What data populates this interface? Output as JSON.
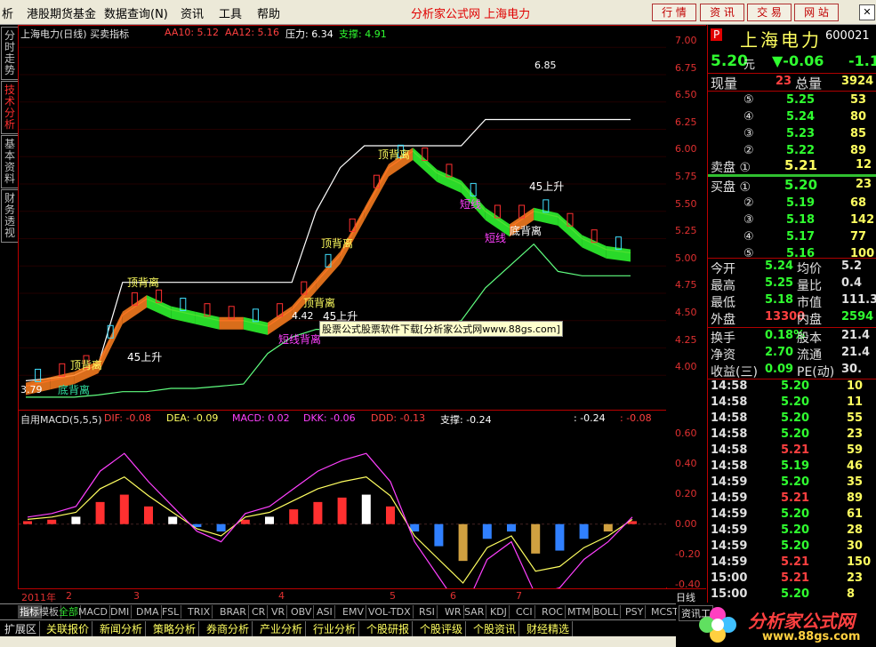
{
  "menu": {
    "items": [
      "析",
      "港股期货基金",
      "数据查询(N)",
      "资讯",
      "工具",
      "帮助"
    ],
    "center_title": "分析家公式网 上海电力",
    "buttons": [
      "行 情",
      "资 讯",
      "交 易",
      "网 站"
    ]
  },
  "left_tabs": [
    "分时走势",
    "技术分析",
    "基本资料",
    "财务透视"
  ],
  "main_header": {
    "stock": "上海电力(日线) 买卖指标",
    "aa10": "AA10: 5.12",
    "aa12": "AA12: 5.16",
    "pressure": "压力: 6.34",
    "support": "支撑: 4.91"
  },
  "macd_header": {
    "name": "自用MACD(5,5,5)",
    "dif": "DIF: -0.08",
    "dea": "DEA: -0.09",
    "macd": "MACD: 0.02",
    "dkk": "DKK: -0.06",
    "ddd": "DDD: -0.13",
    "support": "支撑: -0.24",
    "right1": ": -0.24",
    "right2": ": -0.08"
  },
  "price_axis": [
    "7.00",
    "6.75",
    "6.50",
    "6.25",
    "6.00",
    "5.75",
    "5.50",
    "5.25",
    "5.00",
    "4.75",
    "4.50",
    "4.25",
    "4.00"
  ],
  "macd_axis": [
    "0.60",
    "0.40",
    "0.20",
    "0.00",
    "-0.20",
    "-0.40"
  ],
  "annotations": {
    "high": "6.85",
    "low": "3.79",
    "up45_1": "45上升",
    "up45_2": "45上升",
    "up45_3": "45上升",
    "price_tag": "4.42",
    "top_div1": "顶背离",
    "top_div2": "顶背离",
    "top_div3": "顶背离",
    "top_div4": "顶背离",
    "top_div5": "顶背离",
    "bottom_div1": "底背离",
    "bottom_div2": "底背离",
    "short1": "短线",
    "short2": "短线",
    "short3": "短线背离",
    "ad": "股票公式股票软件下载[分析家公式网www.88gs.com]"
  },
  "date_axis": [
    "2011年",
    "2",
    "3",
    "4",
    "5",
    "6",
    "7",
    "日线"
  ],
  "indicator_tabs": [
    "指标",
    "模板",
    "全部",
    "MACD",
    "DMI",
    "DMA",
    "FSL",
    "TRIX",
    "BRAR",
    "CR",
    "VR",
    "OBV",
    "ASI",
    "EMV",
    "VOL-TDX",
    "RSI",
    "WR",
    "SAR",
    "KDJ",
    "CCI",
    "ROC",
    "MTM",
    "BOLL",
    "PSY",
    "MCST"
  ],
  "bottom_tabs": [
    "扩展区",
    "关联报价",
    "新闻分析",
    "策略分析",
    "券商分析",
    "产业分析",
    "行业分析",
    "个股研报",
    "个股评级",
    "个股资讯",
    "财经精选"
  ],
  "side_label": "资讯工",
  "logo": {
    "title": "分析家公式网",
    "url": "www.88gs.com"
  },
  "quote": {
    "tag": "P",
    "name": "上海电力",
    "code": "600021",
    "price": "5.20",
    "unit": "元",
    "change": "▼-0.06",
    "change_pct": "-1.1",
    "volume_label": "现量",
    "volume": "23",
    "total_label": "总量",
    "total": "3924",
    "sell": [
      {
        "level": "⑤",
        "price": "5.25",
        "vol": "53"
      },
      {
        "level": "④",
        "price": "5.24",
        "vol": "80"
      },
      {
        "level": "③",
        "price": "5.23",
        "vol": "85"
      },
      {
        "level": "②",
        "price": "5.22",
        "vol": "89"
      }
    ],
    "sell1_label": "卖盘 ①",
    "sell1_price": "5.21",
    "sell1_vol": "12",
    "buy1_label": "买盘 ①",
    "buy1_price": "5.20",
    "buy1_vol": "23",
    "buy": [
      {
        "level": "②",
        "price": "5.19",
        "vol": "68"
      },
      {
        "level": "③",
        "price": "5.18",
        "vol": "142"
      },
      {
        "level": "④",
        "price": "5.17",
        "vol": "77"
      },
      {
        "level": "⑤",
        "price": "5.16",
        "vol": "100"
      }
    ],
    "stats": [
      {
        "l1": "今开",
        "v1": "5.24",
        "l2": "均价",
        "v2": "5.2"
      },
      {
        "l1": "最高",
        "v1": "5.25",
        "l2": "量比",
        "v2": "0.4"
      },
      {
        "l1": "最低",
        "v1": "5.18",
        "l2": "市值",
        "v2": "111.3"
      },
      {
        "l1": "外盘",
        "v1": "13300",
        "l2": "内盘",
        "v2": "2594"
      }
    ],
    "stats2": [
      {
        "l1": "换手",
        "v1": "0.18%",
        "l2": "股本",
        "v2": "21.4"
      },
      {
        "l1": "净资",
        "v1": "2.70",
        "l2": "流通",
        "v2": "21.4"
      },
      {
        "l1": "收益(三)",
        "v1": "0.09",
        "l2": "PE(动)",
        "v2": "30."
      }
    ],
    "ticks": [
      {
        "t": "14:58",
        "p": "5.20",
        "v": "10"
      },
      {
        "t": "14:58",
        "p": "5.20",
        "v": "11"
      },
      {
        "t": "14:58",
        "p": "5.20",
        "v": "55"
      },
      {
        "t": "14:58",
        "p": "5.20",
        "v": "23"
      },
      {
        "t": "14:58",
        "p": "5.21",
        "v": "59"
      },
      {
        "t": "14:58",
        "p": "5.19",
        "v": "46"
      },
      {
        "t": "14:59",
        "p": "5.20",
        "v": "35"
      },
      {
        "t": "14:59",
        "p": "5.21",
        "v": "89"
      },
      {
        "t": "14:59",
        "p": "5.20",
        "v": "61"
      },
      {
        "t": "14:59",
        "p": "5.20",
        "v": "28"
      },
      {
        "t": "14:59",
        "p": "5.20",
        "v": "30"
      },
      {
        "t": "14:59",
        "p": "5.21",
        "v": "150"
      },
      {
        "t": "15:00",
        "p": "5.21",
        "v": "23"
      },
      {
        "t": "15:00",
        "p": "5.20",
        "v": "8"
      }
    ]
  },
  "chart_data": [
    {
      "type": "line",
      "title": "上海电力(日线) 买卖指标",
      "ylim": [
        3.75,
        7.1
      ],
      "series": [
        {
          "name": "AA10",
          "values": [
            3.9,
            3.95,
            4.0,
            4.1,
            4.55,
            4.7,
            4.6,
            4.55,
            4.5,
            4.5,
            4.45,
            4.6,
            4.85,
            5.1,
            5.5,
            5.9,
            6.05,
            5.85,
            5.75,
            5.5,
            5.35,
            5.5,
            5.45,
            5.25,
            5.15,
            5.12
          ]
        },
        {
          "name": "压力",
          "values": [
            3.95,
            3.97,
            4.0,
            4.1,
            4.85,
            4.85,
            4.85,
            4.85,
            4.85,
            4.85,
            4.85,
            4.85,
            5.5,
            5.9,
            6.1,
            6.1,
            6.1,
            6.1,
            6.1,
            6.34,
            6.34,
            6.34,
            6.34,
            6.34,
            6.34,
            6.34
          ]
        },
        {
          "name": "支撑",
          "values": [
            3.8,
            3.8,
            3.8,
            3.82,
            3.85,
            3.85,
            3.88,
            3.88,
            3.9,
            3.92,
            4.2,
            4.35,
            4.42,
            4.42,
            4.45,
            4.45,
            4.45,
            4.45,
            4.5,
            4.8,
            5.0,
            5.2,
            4.95,
            4.91,
            4.91,
            4.91
          ]
        }
      ]
    },
    {
      "type": "bar",
      "title": "自用MACD(5,5,5)",
      "ylim": [
        -0.4,
        0.65
      ],
      "values": [
        0.02,
        0.03,
        0.05,
        0.15,
        0.2,
        0.12,
        0.05,
        -0.02,
        -0.05,
        0.03,
        0.05,
        0.1,
        0.15,
        0.18,
        0.2,
        0.12,
        -0.05,
        -0.15,
        -0.25,
        -0.1,
        -0.05,
        -0.2,
        -0.18,
        -0.1,
        -0.05,
        0.02
      ]
    }
  ]
}
